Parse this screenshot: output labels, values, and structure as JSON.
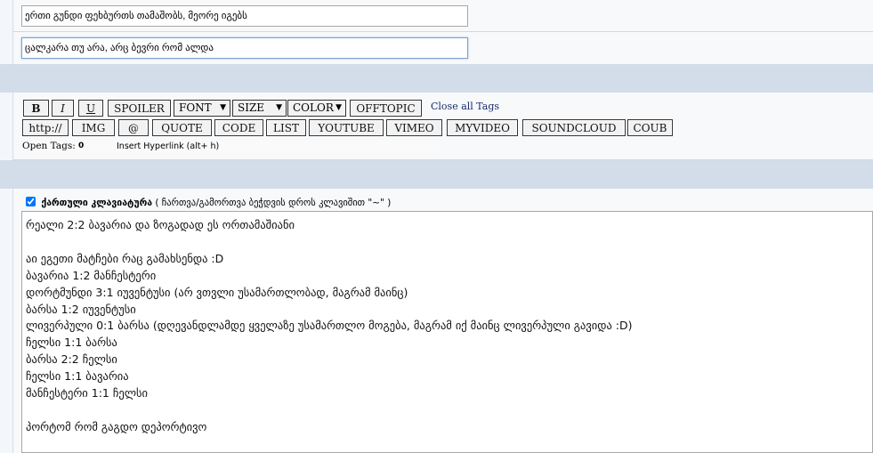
{
  "fields": {
    "title_value": "ერთი გუნდი ფეხბურთს თამაშობს, მეორე იგებს",
    "description_value": "ცალკარა თუ არა, არც ბევრი რომ ალდა"
  },
  "toolbar": {
    "row1": [
      {
        "key": "b",
        "label": "B"
      },
      {
        "key": "i",
        "label": "I"
      },
      {
        "key": "u",
        "label": "U"
      },
      {
        "key": "spoiler",
        "label": "SPOILER"
      }
    ],
    "selects": [
      {
        "key": "font",
        "label": "FONT"
      },
      {
        "key": "size",
        "label": "SIZE"
      },
      {
        "key": "color",
        "label": "COLOR"
      }
    ],
    "offtopic": "OFFTOPIC",
    "close_all": "Close all Tags",
    "row2": [
      "http://",
      "IMG",
      "@",
      "QUOTE",
      "CODE",
      "LIST",
      "YOUTUBE",
      "VIMEO",
      "MYVIDEO",
      "SOUNDCLOUD",
      "COUB"
    ],
    "open_tags_label": "Open Tags:",
    "open_tags_count": "0",
    "hint": "Insert Hyperlink (alt+ h)"
  },
  "keyboard": {
    "label": "ქართული კლავიატურა",
    "note": "( ჩართვა/გამორთვა ბეჭდვის დროს კლავიშით \"~\" )",
    "checked": true
  },
  "post_body": "რეალი 2:2 ბავარია და ზოგადად ეს ორთამაშიანი\n\nაი ეგეთი მატჩები რაც გამახსენდა :D\nბავარია 1:2 მანჩესტერი\nდორტმუნდი 3:1 იუვენტუსი (არ ვთვლი უსამართლობად, მაგრამ მაინც)\nბარსა 1:2 იუვენტუსი\nლივერპული 0:1 ბარსა (დღევანდლამდე ყველაზე უსამართლო მოგება, მაგრამ იქ მაინც ლივერპული გავიდა :D)\nჩელსი 1:1 ბარსა\nბარსა 2:2 ჩელსი\nჩელსი 1:1 ბავარია\nმანჩესტერი 1:1 ჩელსი\n\nპორტომ რომ გაგდო დეპორტივო"
}
